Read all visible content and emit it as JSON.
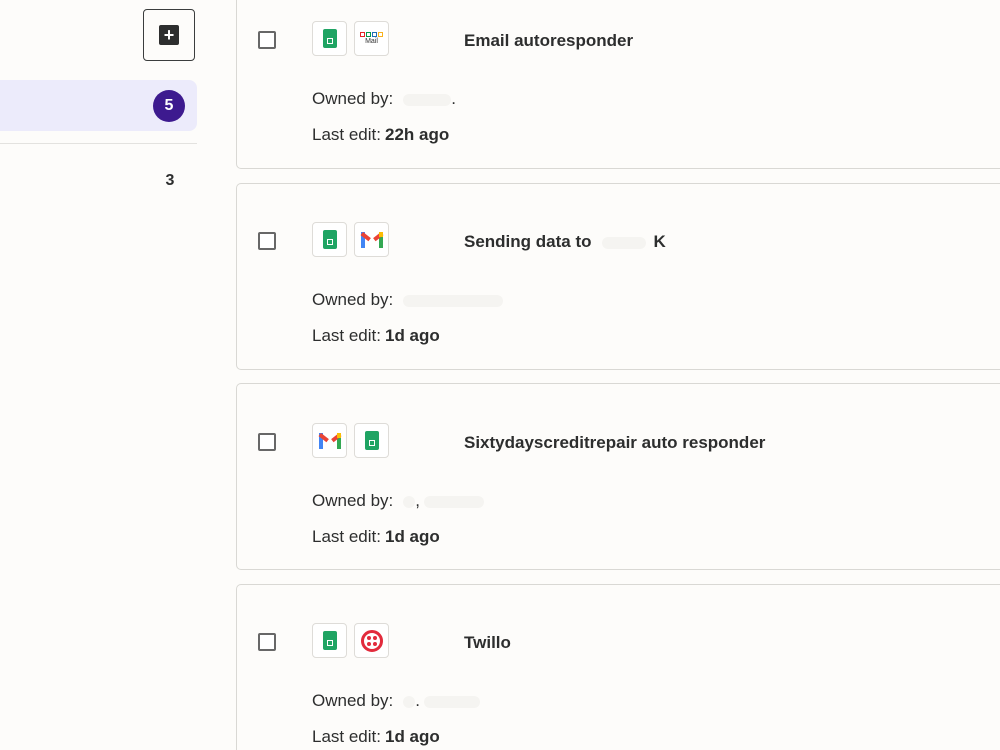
{
  "sidebar": {
    "create_icon": "plus-icon",
    "active_count": "5",
    "second_count": "3"
  },
  "labels": {
    "owned_by": "Owned by:",
    "last_edit": "Last edit:"
  },
  "zaps": [
    {
      "title": "Email autoresponder",
      "apps": [
        "google-sheets-icon",
        "zoho-mail-icon"
      ],
      "owner_suffix": ".",
      "last_edit": "22h ago"
    },
    {
      "title": "Sending data to",
      "title_suffix": "K",
      "apps": [
        "google-sheets-icon",
        "gmail-icon"
      ],
      "owner_suffix": "",
      "last_edit": "1d ago"
    },
    {
      "title": "Sixtydayscreditrepair auto responder",
      "apps": [
        "gmail-icon",
        "google-sheets-icon"
      ],
      "owner_suffix": ",",
      "last_edit": "1d ago"
    },
    {
      "title": "Twillo",
      "apps": [
        "google-sheets-icon",
        "twilio-icon"
      ],
      "owner_suffix": ".",
      "last_edit": "1d ago"
    }
  ],
  "colors": {
    "accent": "#3d1a8f",
    "active_bg": "#ecebfb",
    "sheets": "#1fa463",
    "twilio": "#e22b3c"
  }
}
